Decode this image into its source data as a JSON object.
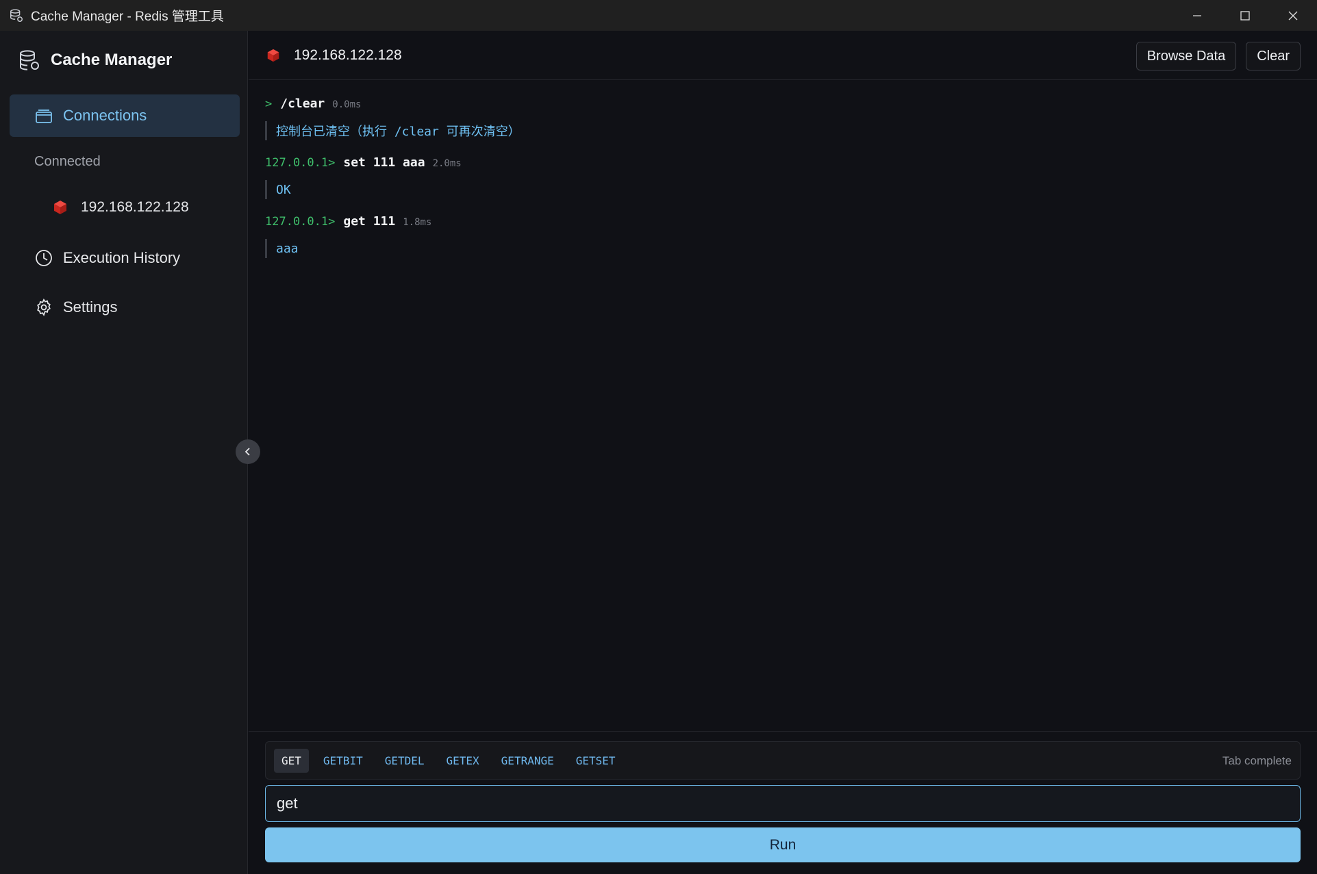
{
  "window": {
    "title": "Cache Manager - Redis 管理工具",
    "icon": "database-icon"
  },
  "sidebar": {
    "brand": "Cache Manager",
    "nav": {
      "connections": "Connections",
      "history": "Execution History",
      "settings": "Settings"
    },
    "section_connected": "Connected",
    "connection_item": "192.168.122.128"
  },
  "main": {
    "server_title": "192.168.122.128",
    "browse_label": "Browse Data",
    "clear_label": "Clear"
  },
  "console": {
    "entries": [
      {
        "prompt": ">",
        "command": "/clear",
        "duration": "0.0ms",
        "result": "控制台已清空（执行 /clear 可再次清空）"
      },
      {
        "prompt": "127.0.0.1>",
        "command": "set 111 aaa",
        "duration": "2.0ms",
        "result": "OK"
      },
      {
        "prompt": "127.0.0.1>",
        "command": "get 111",
        "duration": "1.8ms",
        "result": "aaa"
      }
    ]
  },
  "input": {
    "suggestions": [
      "GET",
      "GETBIT",
      "GETDEL",
      "GETEX",
      "GETRANGE",
      "GETSET"
    ],
    "active_suggestion": "GET",
    "tab_hint": "Tab complete",
    "value": "get",
    "run_label": "Run"
  },
  "colors": {
    "accent": "#7cc4ee",
    "redis_red": "#d8322b",
    "prompt_green": "#3fbf6b"
  }
}
